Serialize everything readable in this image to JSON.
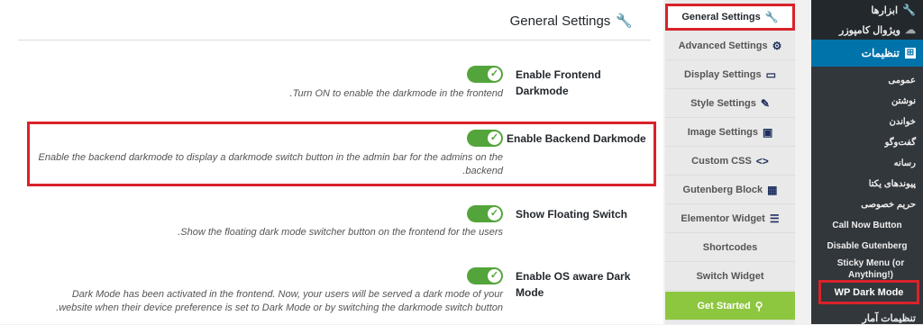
{
  "panel": {
    "title": "General Settings",
    "rows": [
      {
        "label": "Enable Frontend Darkmode",
        "description": "Turn ON to enable the darkmode in the frontend."
      },
      {
        "label": "Enable Backend Darkmode",
        "description": "Enable the backend darkmode to display a darkmode switch button in the admin bar for the admins on the backend."
      },
      {
        "label": "Show Floating Switch",
        "description": "Show the floating dark mode switcher button on the frontend for the users."
      },
      {
        "label": "Enable OS aware Dark Mode",
        "description": "Dark Mode has been activated in the frontend. Now, your users will be served a dark mode of your website when their device preference is set to Dark Mode or by switching the darkmode switch button."
      }
    ]
  },
  "tabs": [
    {
      "label": "General Settings",
      "icon": "wrench-icon"
    },
    {
      "label": "Advanced Settings",
      "icon": "gear-icon"
    },
    {
      "label": "Display Settings",
      "icon": "display-icon"
    },
    {
      "label": "Style Settings",
      "icon": "brush-icon"
    },
    {
      "label": "Image Settings",
      "icon": "image-icon"
    },
    {
      "label": "Custom CSS",
      "icon": "code-icon"
    },
    {
      "label": "Gutenberg Block",
      "icon": "blocks-icon"
    },
    {
      "label": "Elementor Widget",
      "icon": "elementor-icon"
    },
    {
      "label": "Shortcodes",
      "icon": ""
    },
    {
      "label": "Switch Widget",
      "icon": ""
    },
    {
      "label": "Get Started",
      "icon": "pin-icon"
    }
  ],
  "sidebar": {
    "top": [
      {
        "label": "ابزارها",
        "icon": "wrench-icon"
      },
      {
        "label": "ویژوال کامپوزر",
        "icon": "composer-icon"
      }
    ],
    "active": {
      "label": "تنظیمات",
      "icon": "settings-icon"
    },
    "submenu": [
      "عمومی",
      "نوشتن",
      "خواندن",
      "گفت‌وگو",
      "رسانه",
      "پیوندهای یکتا",
      "حریم خصوصی",
      "Call Now Button",
      "Disable Gutenberg",
      "Sticky Menu (or Anything!)"
    ],
    "dark_mode": "WP Dark Mode",
    "bottom": "تنظیمات آمار"
  },
  "colors": {
    "accent": "#0073aa",
    "toggle": "#53a53b",
    "highlight": "#d9222a",
    "started": "#8dc63f"
  }
}
